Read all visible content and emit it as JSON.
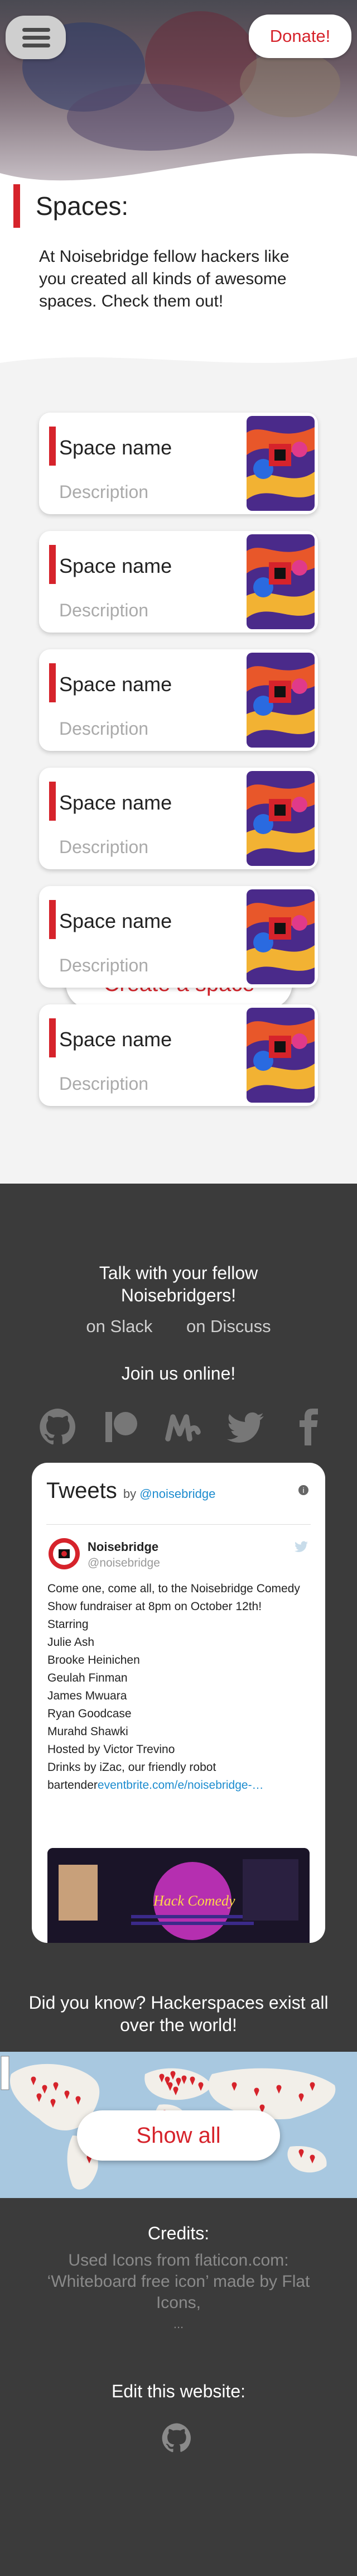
{
  "header": {
    "donate_label": "Donate!",
    "menu_icon": "hamburger-icon"
  },
  "spaces": {
    "title": "Spaces:",
    "intro": "At Noisebridge fellow hackers like you created all kinds of awesome spaces. Check them out!",
    "cards": [
      {
        "name": "Space name",
        "description": "Description"
      },
      {
        "name": "Space name",
        "description": "Description"
      },
      {
        "name": "Space name",
        "description": "Description"
      },
      {
        "name": "Space name",
        "description": "Description"
      },
      {
        "name": "Space name",
        "description": "Description"
      },
      {
        "name": "Space name",
        "description": "Description"
      }
    ],
    "create_label": "Create a space"
  },
  "community": {
    "talk": "Talk with your fellow Noisebridgers!",
    "slack": "on Slack",
    "discuss": "on Discuss",
    "join": "Join us online!",
    "social_icons": [
      "github-icon",
      "patreon-icon",
      "meetup-icon",
      "twitter-icon",
      "facebook-icon"
    ]
  },
  "tweets": {
    "title": "Tweets",
    "by": "by",
    "handle_link": "@noisebridge",
    "author_name": "Noisebridge",
    "author_handle": "@noisebridge",
    "text_lines": [
      "Come one, come all, to the Noisebridge Comedy Show fundraiser at 8pm on October 12th!",
      "Starring",
      "Julie Ash",
      "Brooke Heinichen",
      "Geulah Finman",
      "James Mwuara",
      "Ryan Goodcase",
      "Murahd Shawki",
      "Hosted by Victor Trevino",
      "Drinks by iZac, our friendly robot"
    ],
    "link_prefix": "bartender",
    "link": "eventbrite.com/e/noisebridge-…",
    "image_title": "Hack Comedy"
  },
  "hackerspaces": {
    "title": "Did you know? Hackerspaces exist all over the world!",
    "show_all": "Show all"
  },
  "credits": {
    "title": "Credits:",
    "text": "Used Icons from flaticon.com: ‘Whiteboard free icon’ made by Flat Icons,",
    "more": "..."
  },
  "edit": {
    "title": "Edit this website:"
  },
  "colors": {
    "accent": "#d6232b",
    "dark_bg": "#3b3b3b",
    "link": "#1d8ccf"
  }
}
